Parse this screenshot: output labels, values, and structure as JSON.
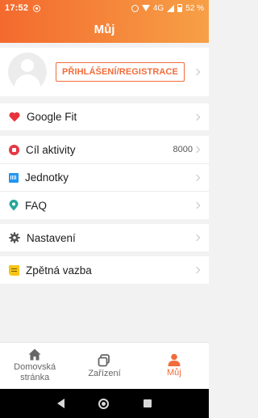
{
  "status_bar": {
    "time": "17:52",
    "network": "4G",
    "battery": "52 %"
  },
  "header": {
    "title": "Můj"
  },
  "profile": {
    "login_label": "PŘIHLÁŠENÍ/REGISTRACE"
  },
  "menu": {
    "google_fit": "Google Fit",
    "activity_goal": "Cíl aktivity",
    "activity_goal_value": "8000",
    "units": "Jednotky",
    "faq": "FAQ",
    "settings": "Nastavení",
    "feedback": "Zpětná vazba"
  },
  "bottom_nav": {
    "home_line1": "Domovská",
    "home_line2": "stránka",
    "devices": "Zařízení",
    "mine": "Můj"
  },
  "colors": {
    "accent": "#f26c3a",
    "header_start": "#f46a2e",
    "header_end": "#f7a046"
  },
  "icons": [
    "heart-icon",
    "target-icon",
    "units-icon",
    "faq-icon",
    "gear-icon",
    "feedback-icon",
    "home-icon",
    "devices-icon",
    "person-icon"
  ]
}
